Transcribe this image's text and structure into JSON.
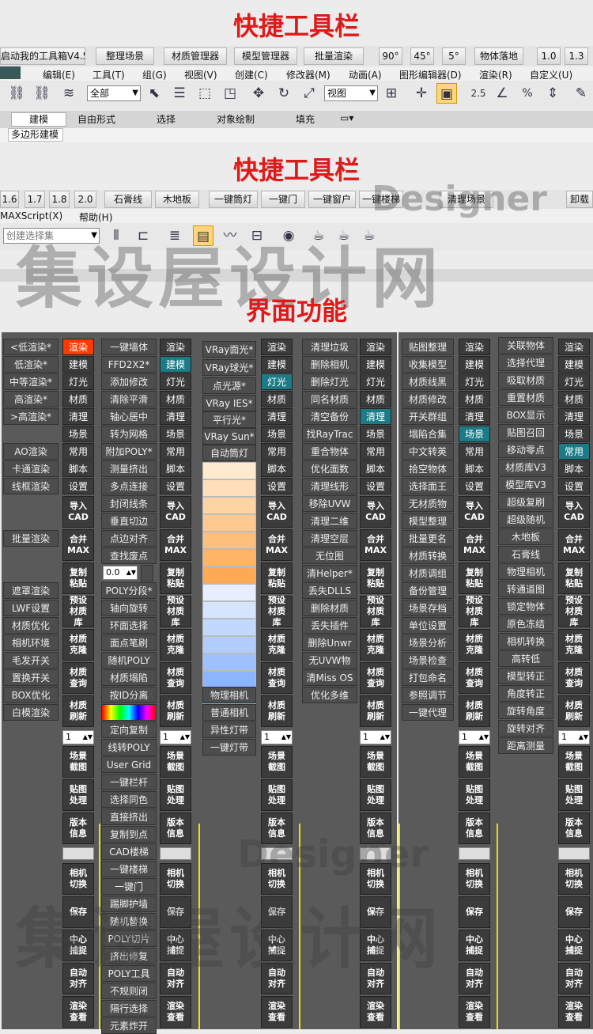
{
  "titles": {
    "t1": "快捷工具栏",
    "t2": "快捷工具栏",
    "t3": "界面功能"
  },
  "top_bar": [
    "启动我的工具箱V4.5",
    "整理场景",
    "材质管理器",
    "模型管理器",
    "批量渲染",
    "90°",
    "45°",
    "5°",
    "物体落地",
    "1.0",
    "1.3"
  ],
  "menu1": [
    "编辑(E)",
    "工具(T)",
    "组(G)",
    "视图(V)",
    "创建(C)",
    "修改器(M)",
    "动画(A)",
    "图形编辑器(D)",
    "渲染(R)",
    "自定义(U)"
  ],
  "toolbar1": {
    "select_all": "全部",
    "view": "视图",
    "num": "2.5",
    "pct": "%"
  },
  "ribbon_tabs": [
    "建模",
    "自由形式",
    "选择",
    "对象绘制",
    "填充"
  ],
  "ribbon_sub": "多边形建模",
  "bar2": [
    "1.6",
    "1.7",
    "1.8",
    "2.0",
    "石膏线",
    "木地板",
    "一键筒灯",
    "一键门",
    "一键窗户",
    "一键楼梯",
    "清理场景",
    "卸载"
  ],
  "menu2": [
    "MAXScript(X)",
    "帮助(H)"
  ],
  "toolbar2": {
    "selset": "创建选择集"
  },
  "watermark": {
    "top": "集设屋设计网",
    "mid": "Designer",
    "bottom": "集设屋设计网",
    "bottom_sub": "Designer"
  },
  "panels": {
    "p1_left": [
      "<低渲染*",
      "低渲染*",
      "中等渲染*",
      "高渲染*",
      ">高渲染*",
      "",
      "AO渲染",
      "卡通渲染",
      "线框渲染",
      "",
      "",
      "批量渲染",
      "",
      "",
      "遮罩渲染",
      "LWF设置",
      "材质优化",
      "相机环境",
      "毛发开关",
      "置换开关",
      "BOX优化",
      "白模渲染"
    ],
    "p2_left": [
      "一键墙体",
      "FFD2X2*",
      "添加修改",
      "清除平滑",
      "轴心居中",
      "转为网格",
      "附加POLY*",
      "测量挤出",
      "多点连接",
      "封闭线条",
      "垂直切边",
      "点边对齐",
      "查找废点",
      "0.0",
      "POLY分段*",
      "轴向旋转",
      "环面选择",
      "面点笔刷",
      "随机POLY",
      "材质塌陷",
      "按ID分离",
      "",
      "定向复制",
      "线转POLY",
      "User Grid",
      "一键栏杆",
      "选择同色",
      "直接挤出",
      "复制到点",
      "CAD楼梯",
      "一键楼梯",
      "一键门",
      "踢脚护墙",
      "随机替换",
      "POLY切片",
      "挤出修复",
      "POLY工具",
      "不规则闭",
      "隔行选择",
      "元素炸开"
    ],
    "p3_left": [
      "VRay面光*",
      "VRay球光*",
      "点光源*",
      "VRay IES*",
      "平行光*",
      "VRay Sun*",
      "自动筒灯",
      "物理相机",
      "普通相机",
      "异性灯带",
      "一键灯带"
    ],
    "p4_left": [
      "清理垃圾",
      "删除相机",
      "删除灯光",
      "同名材质",
      "清空备份",
      "找RayTrac",
      "重合物体",
      "优化面数",
      "清理线形",
      "移除UVW",
      "清理二维",
      "清理空层",
      "无位图",
      "清Helper*",
      "丢失DLLS",
      "删除材质",
      "丢失插件",
      "删除Unwr",
      "无UVW物",
      "清Miss OS",
      "优化多维"
    ],
    "p5_left": [
      "贴图整理",
      "收集模型",
      "材质线黑",
      "材质修改",
      "开关群组",
      "塌陷合集",
      "中文转英",
      "拾空物体",
      "选择面王",
      "无材质物",
      "模型整理",
      "批量更名",
      "材质转换",
      "材质调组",
      "备份管理",
      "场景存档",
      "单位设置",
      "场景分析",
      "场景检查",
      "打包命名",
      "参照调节",
      "一键代理"
    ],
    "p6_left": [
      "关联物体",
      "选择代理",
      "吸取材质",
      "重置材质",
      "BOX显示",
      "贴图召回",
      "移动零点",
      "材质库V3",
      "模型库V3",
      "超级复刷",
      "超级随机",
      "木地板",
      "石膏线",
      "物理相机",
      "转通道图",
      "锁定物体",
      "原色冻结",
      "相机转换",
      "高转低",
      "模型转正",
      "角度转正",
      "旋转角度",
      "旋转对齐",
      "距离测量"
    ],
    "right_btns": [
      "渲染",
      "建模",
      "灯光",
      "材质",
      "清理",
      "场景",
      "常用",
      "脚本",
      "设置"
    ],
    "right_big": [
      "导入CAD",
      "合并MAX",
      "复制粘贴",
      "预设材质库",
      "材质克隆",
      "材质查询",
      "材质刷新",
      "1",
      "场景截图",
      "贴图处理",
      "版本信息",
      "",
      "相机切换",
      "保存",
      "中心捕捉",
      "自动对齐",
      "渲染查看"
    ]
  }
}
